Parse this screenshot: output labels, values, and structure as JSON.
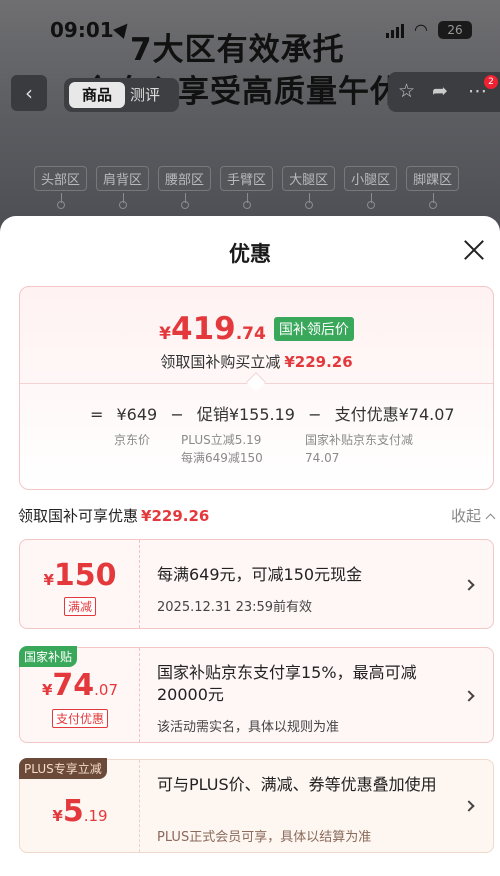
{
  "status_bar": {
    "time": "09:01",
    "battery": "26"
  },
  "overlay": {
    "line1": "7大区有效承托",
    "line2": "全身心享受高质量午休"
  },
  "nav": {
    "tab_product": "商品",
    "tab_review": "测评",
    "badge": "2"
  },
  "zones": [
    "头部区",
    "肩背区",
    "腰部区",
    "手臂区",
    "大腿区",
    "小腿区",
    "脚踝区"
  ],
  "sheet": {
    "title": "优惠",
    "final_price": {
      "currency": "¥",
      "int": "419",
      "dec": ".74",
      "tag": "国补领后价"
    },
    "saving": {
      "label": "领取国补购买立减",
      "amount": "¥229.26"
    },
    "calc": {
      "eq": "=",
      "jd_price": "¥649",
      "minus1": "−",
      "promo": "促销¥155.19",
      "minus2": "−",
      "pay": "支付优惠¥74.07"
    },
    "calc_subs": {
      "jd_price_label": "京东价",
      "promo_line1": "PLUS立减5.19",
      "promo_line2": "每满649减150",
      "pay_line1": "国家补贴京东支付减",
      "pay_line2": "74.07"
    },
    "section": {
      "label": "领取国补可享优惠",
      "amount": "¥229.26",
      "collapse": "收起"
    },
    "coupons": [
      {
        "yen": "¥",
        "int": "150",
        "dec": "",
        "type": "满减",
        "corner": "",
        "main": "每满649元，可减150元现金",
        "sub": "2025.12.31 23:59前有效"
      },
      {
        "yen": "¥",
        "int": "74",
        "dec": ".07",
        "type": "支付优惠",
        "corner": "国家补贴",
        "main": "国家补贴京东支付享15%，最高可减20000元",
        "sub": "该活动需实名，具体以规则为准"
      },
      {
        "yen": "¥",
        "int": "5",
        "dec": ".19",
        "type": "",
        "corner": "PLUS专享立减",
        "main": "可与PLUS价、满减、券等优惠叠加使用",
        "sub": "PLUS正式会员可享，具体以结算为准"
      }
    ],
    "colors": {
      "accent_red": "#e4393c",
      "subsidy_green": "#39a85b",
      "plus_brown": "#6b4a3a"
    }
  }
}
